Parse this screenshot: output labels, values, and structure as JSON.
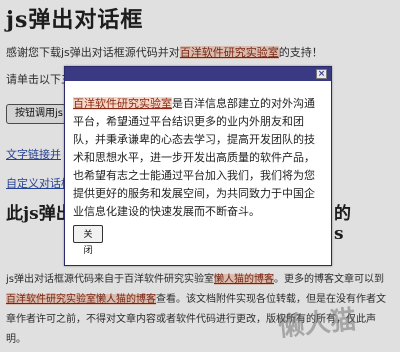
{
  "page": {
    "title": "js弹出对话框",
    "thanks_prefix": "感谢您下载js弹出对话框源代码并对",
    "thanks_link": "百洋软件研究实验室",
    "thanks_suffix": "的支持！",
    "intro": "请单击以下三个",
    "button_label": "按钮调用js",
    "text_link": "文字链接并",
    "custom_link": "自定义对话框",
    "heading_left": "此js弹出所有主流弹出对话",
    "heading_right_1": "的",
    "heading_right_2": "s",
    "body_intro": "js弹出对话框源代码来自于百洋软件研究实验室",
    "body_blog": "懒人猫的博客",
    "body_after_blog": "。更多的博客文章可以到",
    "body_company": "百洋软件研究实验室",
    "body_blog2": "懒人猫的博客",
    "body_view": "查看。该文档附件实现各位转载，但是在没有作者文章作者许可之前，不得对文章内容或者软件代码进行更改，版权所有",
    "body_rights": "的所有，仅此声明。"
  },
  "dialog": {
    "close_icon": "×",
    "company": "百洋软件研究实验室",
    "text": "是百洋信息部建立的对外沟通平台，希望通过平台结识更多的业内外朋友和团队，并秉承谦卑的心态去学习，提高开发团队的技术和思想水平，进一步开发出高质量的软件产品，也希望有志之士能通过平台加入我们，我们将为您提供更好的服务和发展空间，为共同致力于中国企业信息化建设的快速发展而不断奋斗。",
    "close_button": "关闭"
  },
  "watermark": "懒人猫"
}
